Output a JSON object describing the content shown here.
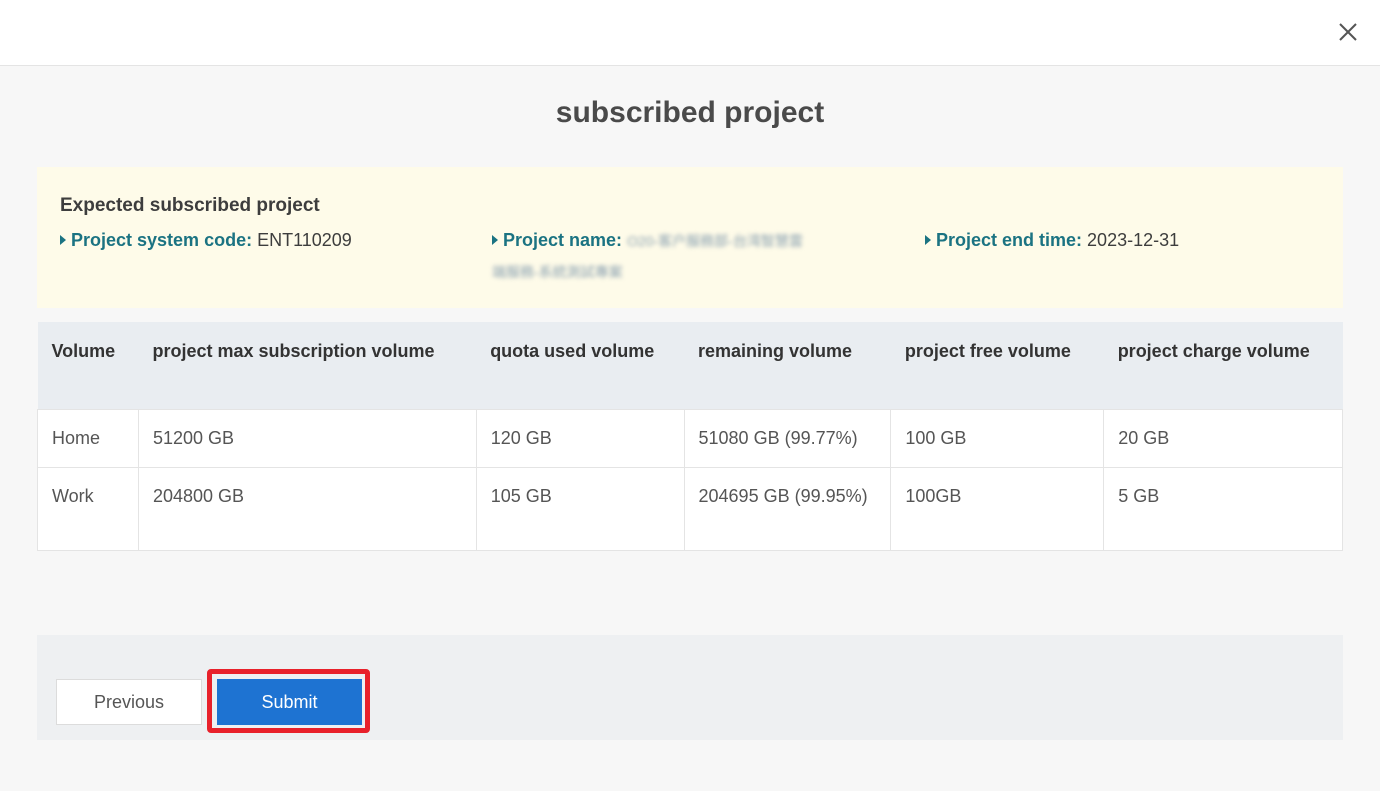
{
  "dialog": {
    "close_icon": "close-icon",
    "title": "subscribed project"
  },
  "project_info": {
    "heading": "Expected subscribed project",
    "system_code_label": "Project system code:",
    "system_code_value": "ENT110209",
    "name_label": "Project name:",
    "name_value_line1": "O20-客户服務部-台湾智慧雲",
    "name_value_line2": "端服務-系統測試專案",
    "end_time_label": "Project end time:",
    "end_time_value": "2023-12-31"
  },
  "table": {
    "headers": [
      "Volume",
      "project max subscription volume",
      "quota used volume",
      "remaining volume",
      "project free volume",
      "project charge volume"
    ],
    "rows": [
      [
        "Home",
        "51200 GB",
        "120 GB",
        "51080 GB (99.77%)",
        "100 GB",
        "20 GB"
      ],
      [
        "Work",
        "204800 GB",
        "105 GB",
        "204695 GB (99.95%)",
        "100GB",
        "5 GB"
      ]
    ]
  },
  "footer": {
    "previous_label": "Previous",
    "submit_label": "Submit"
  },
  "colors": {
    "accent": "#1e73d2",
    "label_teal": "#1b7382",
    "highlight": "#e8212b"
  }
}
